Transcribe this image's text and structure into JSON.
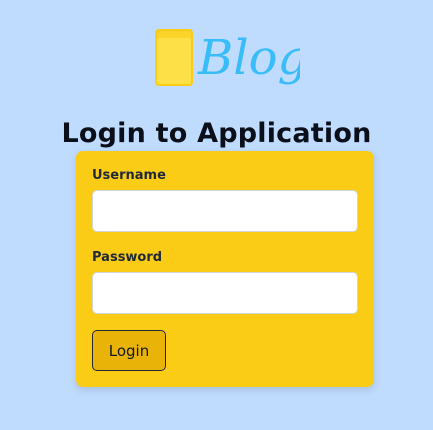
{
  "logo": {
    "text": "Blogs",
    "icon": "glass-icon",
    "colors": {
      "icon_fill": "#fde047",
      "icon_outline": "#eab308",
      "text": "#38bdf8"
    }
  },
  "page": {
    "title": "Login to Application",
    "background": "#bfdbfe"
  },
  "form": {
    "background": "#facc15",
    "username": {
      "label": "Username",
      "value": "",
      "placeholder": ""
    },
    "password": {
      "label": "Password",
      "value": "",
      "placeholder": ""
    },
    "submit_label": "Login"
  }
}
